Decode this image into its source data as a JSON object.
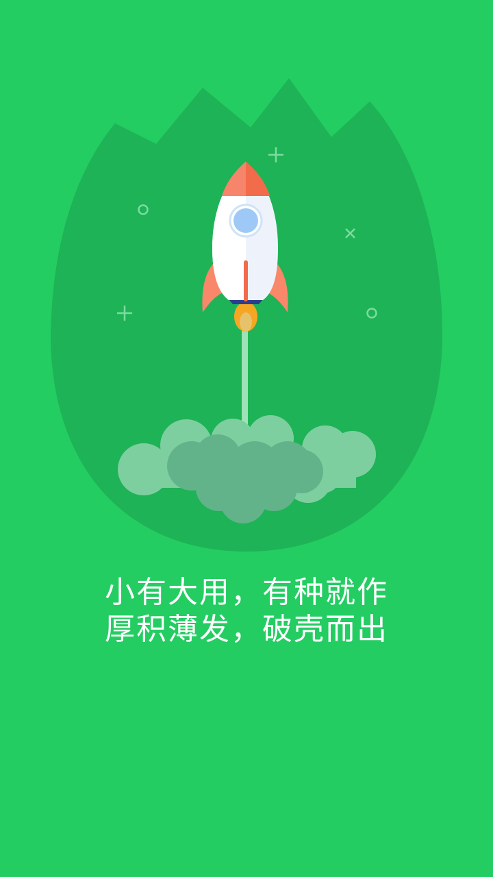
{
  "splash": {
    "background_color": "#23cd62",
    "shell_color": "#1eb356",
    "slogan_line_1": "小有大用，有种就作",
    "slogan_line_2": "厚积薄发，破壳而出"
  },
  "illustration": {
    "icons": [
      "cracked-shell-icon",
      "rocket-icon",
      "cloud-smoke-icon",
      "plus-icon",
      "circle-icon",
      "cross-icon"
    ]
  }
}
